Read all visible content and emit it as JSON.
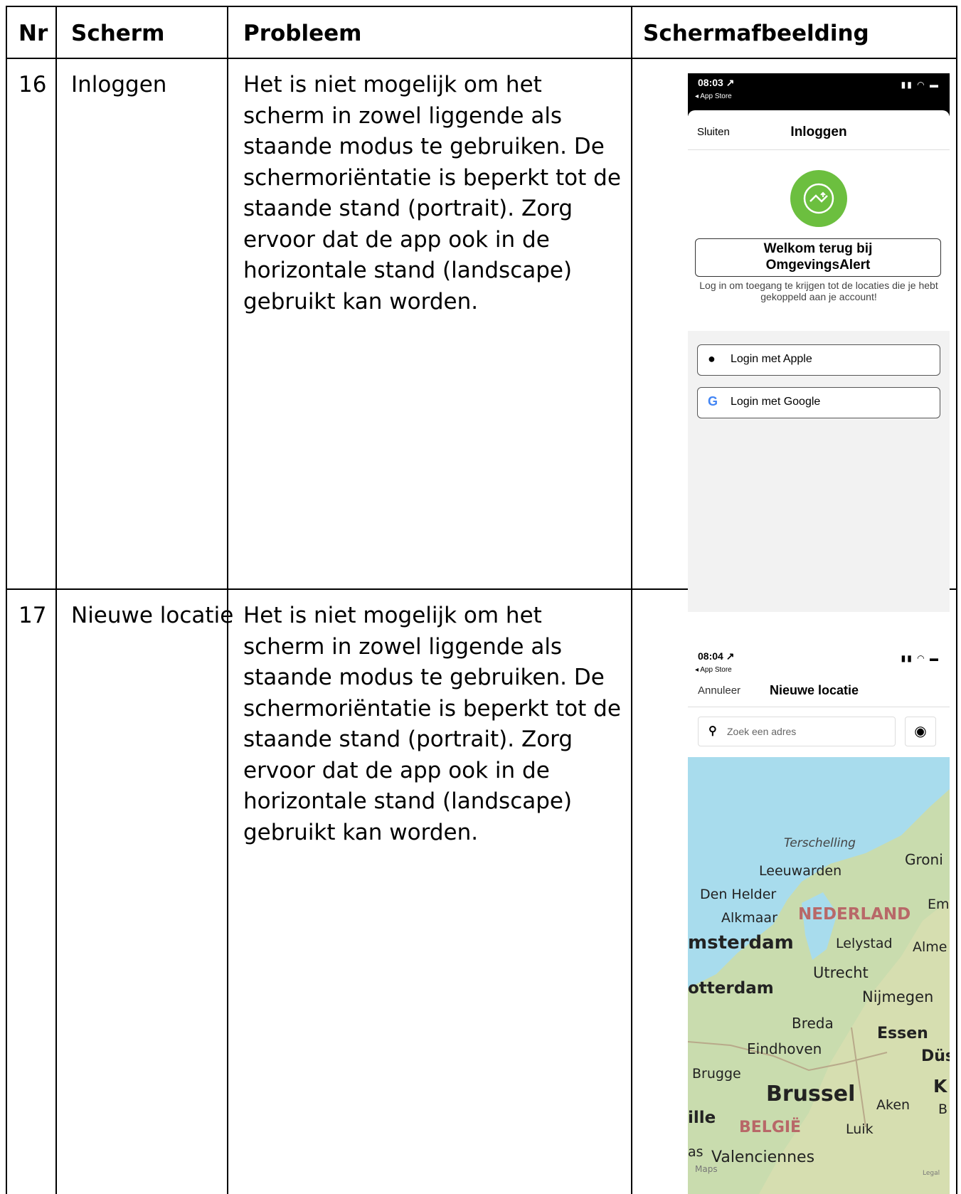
{
  "header": {
    "nr": "Nr",
    "scherm": "Scherm",
    "probleem": "Probleem",
    "afbeelding": "Schermafbeelding"
  },
  "rows": [
    {
      "nr": "16",
      "scherm": "Inloggen",
      "probleem": "Het is niet mogelijk om het scherm in zowel liggende als staande modus te gebruiken. De schermoriëntatie is beperkt tot de staande stand (portrait). Zorg ervoor dat de app ook in de horizontale stand (landscape) gebruikt kan worden."
    },
    {
      "nr": "17",
      "scherm": "Nieuwe locatie",
      "probleem": "Het is niet mogelijk om het scherm in zowel liggende als staande modus te gebruiken. De schermoriëntatie is beperkt tot de staande stand (portrait). Zorg ervoor dat de app ook in de horizontale stand (landscape) gebruikt kan worden."
    }
  ],
  "login_screen": {
    "time": "08:03 ↗",
    "back": "◂ App Store",
    "close": "Sluiten",
    "title": "Inloggen",
    "welcome": "Welkom terug bij OmgevingsAlert",
    "subtitle": "Log in om toegang te krijgen tot de locaties die je hebt gekoppeld aan je account!",
    "apple": "Login met Apple",
    "google": "Login met Google",
    "accent": "#6cbf3f"
  },
  "location_screen": {
    "time": "08:04 ↗",
    "back": "◂ App Store",
    "cancel": "Annuleer",
    "title": "Nieuwe locatie",
    "search_placeholder": "Zoek een adres",
    "map_labels": {
      "terschelling": "Terschelling",
      "groningen": "Groni",
      "leeuwarden": "Leeuwarden",
      "denhelder": "Den Helder",
      "emmen": "Em",
      "alkmaar": "Alkmaar",
      "nederland": "NEDERLAND",
      "amsterdam": "msterdam",
      "lelystad": "Lelystad",
      "almere": "Alme",
      "utrecht": "Utrecht",
      "rotterdam": "otterdam",
      "nijmegen": "Nijmegen",
      "breda": "Breda",
      "essen": "Essen",
      "eindhoven": "Eindhoven",
      "dusseldorf": "Düs",
      "brugge": "Brugge",
      "brussel": "Brussel",
      "koln": "K",
      "aken": "Aken",
      "bonn": "B",
      "lille": "ille",
      "belgie": "BELGIË",
      "luik": "Luik",
      "valenciennes": "Valenciennes",
      "as": "as",
      "maps": "Maps",
      "legal": "Legal"
    }
  }
}
